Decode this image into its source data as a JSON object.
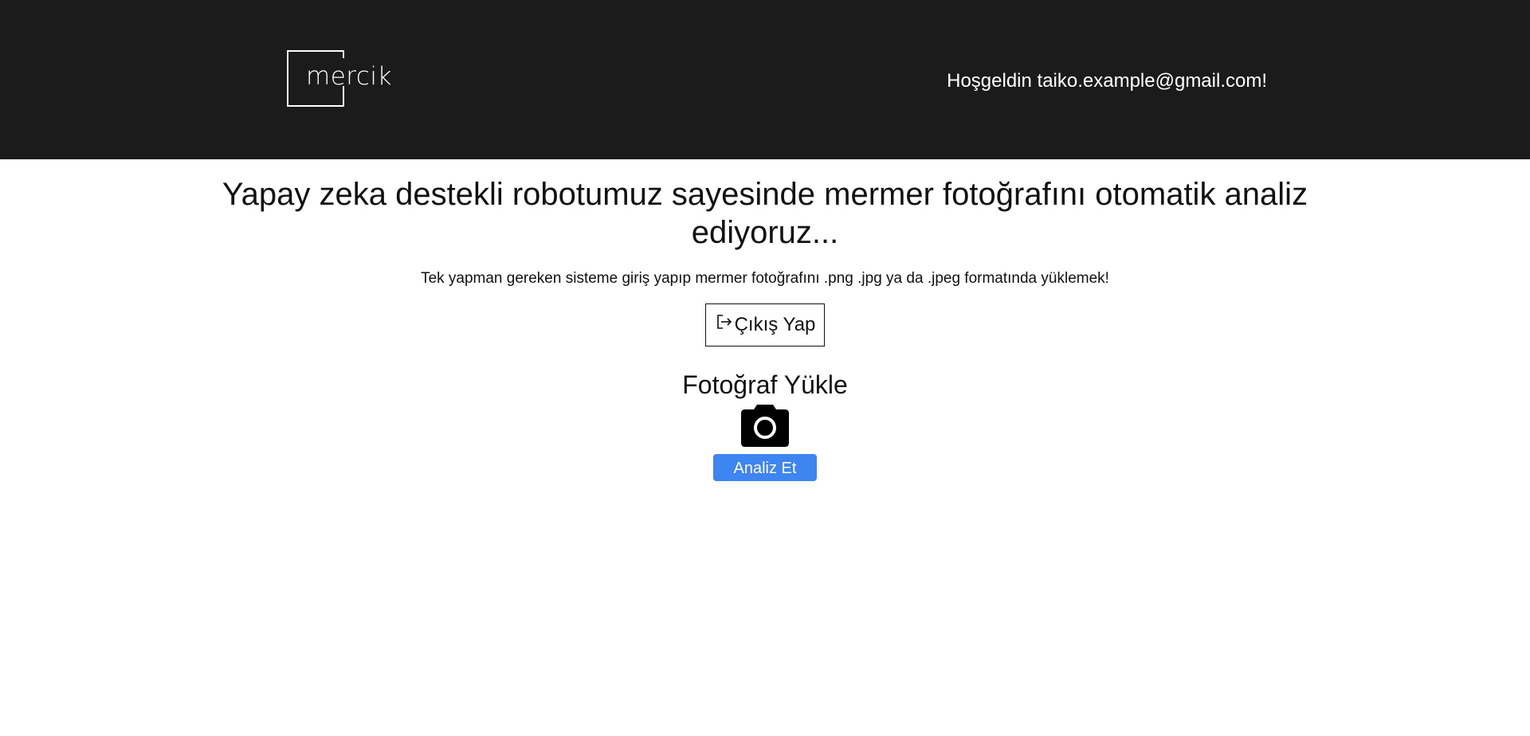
{
  "header": {
    "logo_text": "mercik",
    "welcome_text": "Hoşgeldin taiko.example@gmail.com!"
  },
  "main": {
    "headline": "Yapay zeka destekli robotumuz sayesinde mermer fotoğrafını otomatik analiz ediyoruz...",
    "subtext": "Tek yapman gereken sisteme giriş yapıp mermer fotoğrafını .png .jpg ya da .jpeg formatında yüklemek!",
    "logout_label": "Çıkış Yap",
    "logout_icon": "logout-icon",
    "upload_title": "Fotoğraf Yükle",
    "camera_icon": "camera-icon",
    "analyze_label": "Analiz Et"
  },
  "colors": {
    "header_bg": "#1b1b1b",
    "accent_button": "#3d85f1"
  }
}
